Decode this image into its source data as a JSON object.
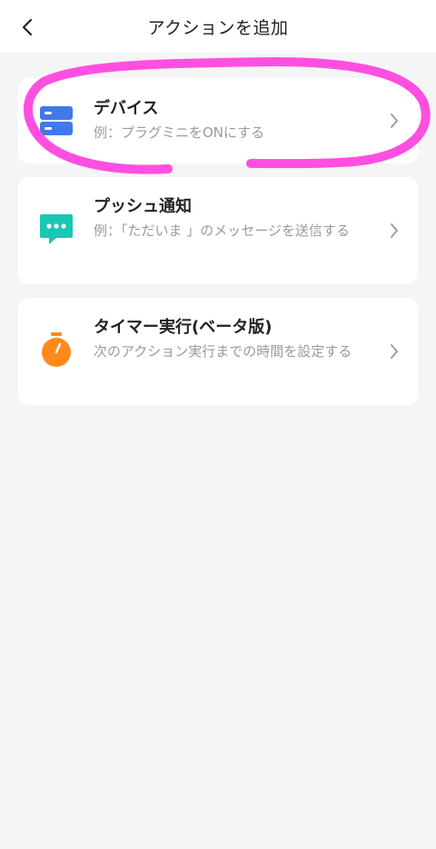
{
  "header": {
    "title": "アクションを追加",
    "back_icon": "chevron-left-icon"
  },
  "actions": [
    {
      "title": "デバイス",
      "description": "例：プラグミニをONにする",
      "icon": "device-icon",
      "icon_color": "#3f7ae8"
    },
    {
      "title": "プッシュ通知",
      "description": "例：「ただいま 」のメッセージを送信する",
      "icon": "chat-bubble-icon",
      "icon_color": "#1bc6b4"
    },
    {
      "title": "タイマー実行(ベータ版)",
      "description": "次のアクション実行までの時間を設定する",
      "icon": "stopwatch-icon",
      "icon_color": "#ff8a1c"
    }
  ],
  "colors": {
    "background": "#f5f5f5",
    "card": "#ffffff",
    "annotation": "#ff4fe0"
  }
}
